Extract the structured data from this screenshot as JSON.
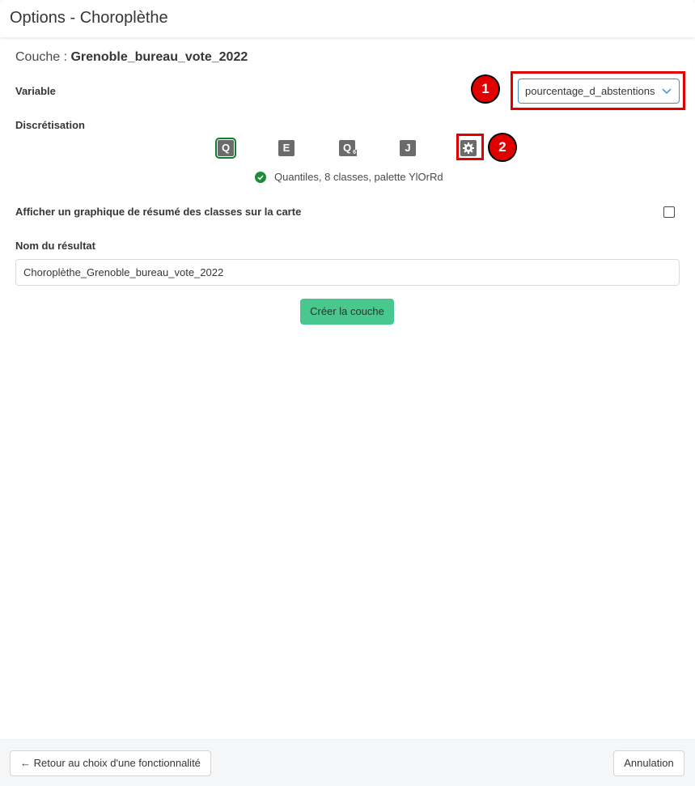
{
  "window": {
    "title": "Options - Choroplèthe"
  },
  "layer": {
    "prefix": "Couche : ",
    "name": "Grenoble_bureau_vote_2022"
  },
  "variable": {
    "label": "Variable",
    "selected": "pourcentage_d_abstentions"
  },
  "discretisation": {
    "label": "Discrétisation",
    "methods": [
      {
        "letter": "Q",
        "icon": "quantiles-icon",
        "selected": true
      },
      {
        "letter": "E",
        "icon": "equal-intervals-icon",
        "selected": false
      },
      {
        "letter": "Q",
        "sub": "6",
        "icon": "q6-icon",
        "selected": false
      },
      {
        "letter": "J",
        "icon": "jenks-icon",
        "selected": false
      }
    ],
    "settings_icon": "gear-icon",
    "status": "Quantiles, 8 classes, palette YlOrRd",
    "status_color": "#1e8c3a"
  },
  "summary_chart": {
    "label": "Afficher un graphique de résumé des classes sur la carte",
    "checked": false
  },
  "result_name": {
    "label": "Nom du résultat",
    "value": "Choroplèthe_Grenoble_bureau_vote_2022"
  },
  "create_button": {
    "label": "Créer la couche",
    "color": "#48c78e"
  },
  "annotations": {
    "one": "1",
    "two": "2",
    "color": "#e00000"
  },
  "footer": {
    "back_label": "Retour au choix d'une fonctionnalité",
    "cancel_label": "Annulation"
  }
}
